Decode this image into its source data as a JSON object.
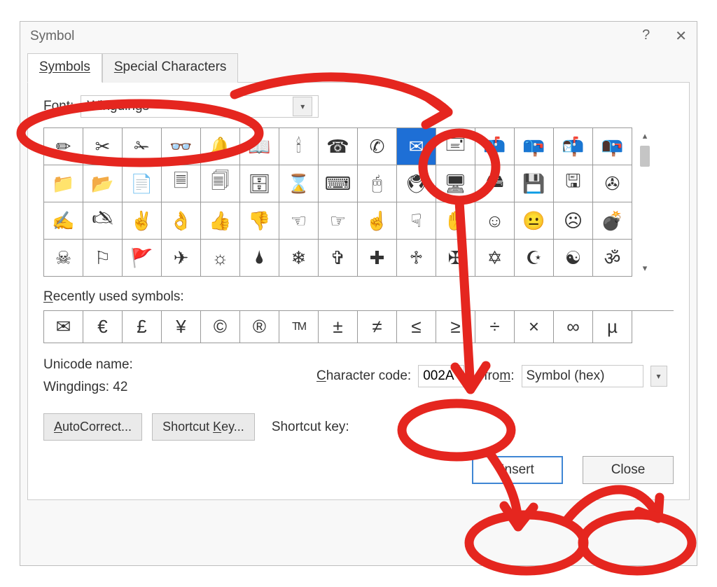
{
  "title": "Symbol",
  "tabs": {
    "symbols": "Symbols",
    "special": "Special Characters"
  },
  "font": {
    "label": "Font:",
    "value": "Wingdings"
  },
  "grid": [
    [
      "pencil-icon",
      "✏"
    ],
    [
      "scissors-icon",
      "✂"
    ],
    [
      "scissors-cut-icon",
      "✁"
    ],
    [
      "glasses-icon",
      "👓"
    ],
    [
      "bell-icon",
      "🔔"
    ],
    [
      "book-open-icon",
      "📖"
    ],
    [
      "candle-icon",
      "🕯"
    ],
    [
      "telephone-icon",
      "☎"
    ],
    [
      "telephone-rotary-icon",
      "✆"
    ],
    [
      "envelope-icon",
      "✉"
    ],
    [
      "envelope-stamped-icon",
      "🖃"
    ],
    [
      "mailbox-flag-up-icon",
      "📫"
    ],
    [
      "mailbox-flag-down-icon",
      "📪"
    ],
    [
      "mailbox-open-flag-icon",
      "📬"
    ],
    [
      "mailbox-open-icon",
      "📭"
    ],
    [
      "folder-icon",
      "📁"
    ],
    [
      "folder-open-icon",
      "📂"
    ],
    [
      "document-icon",
      "📄"
    ],
    [
      "page-icon",
      "🗏"
    ],
    [
      "documents-icon",
      "🗐"
    ],
    [
      "filing-cabinet-icon",
      "🗄"
    ],
    [
      "hourglass-icon",
      "⌛"
    ],
    [
      "keyboard-icon",
      "⌨"
    ],
    [
      "mouse-icon",
      "🖰"
    ],
    [
      "trackball-icon",
      "🖲"
    ],
    [
      "computer-icon",
      "🖥"
    ],
    [
      "hard-disk-icon",
      "🖴"
    ],
    [
      "floppy-disk-icon",
      "💾"
    ],
    [
      "floppy-disk-inverse-icon",
      "🖫"
    ],
    [
      "tape-icon",
      "✇"
    ],
    [
      "write-hand-icon",
      "✍"
    ],
    [
      "write-hand-left-icon",
      "🖎"
    ],
    [
      "victory-hand-icon",
      "✌"
    ],
    [
      "ok-hand-icon",
      "👌"
    ],
    [
      "thumbs-up-icon",
      "👍"
    ],
    [
      "thumbs-down-icon",
      "👎"
    ],
    [
      "point-left-icon",
      "☜"
    ],
    [
      "point-right-icon",
      "☞"
    ],
    [
      "point-up-icon",
      "☝"
    ],
    [
      "point-down-icon",
      "☟"
    ],
    [
      "open-hand-icon",
      "✋"
    ],
    [
      "smile-icon",
      "☺"
    ],
    [
      "neutral-face-icon",
      "😐"
    ],
    [
      "frown-icon",
      "☹"
    ],
    [
      "bomb-icon",
      "💣"
    ],
    [
      "skull-crossbones-icon",
      "☠"
    ],
    [
      "flag-icon",
      "⚐"
    ],
    [
      "pennant-icon",
      "🚩"
    ],
    [
      "airplane-icon",
      "✈"
    ],
    [
      "sun-icon",
      "☼"
    ],
    [
      "droplet-icon",
      "🌢"
    ],
    [
      "snowflake-icon",
      "❄"
    ],
    [
      "latin-cross-icon",
      "✞"
    ],
    [
      "cross-icon",
      "✚"
    ],
    [
      "celtic-cross-icon",
      "♱"
    ],
    [
      "maltese-cross-icon",
      "✠"
    ],
    [
      "star-of-david-icon",
      "✡"
    ],
    [
      "star-crescent-icon",
      "☪"
    ],
    [
      "yin-yang-icon",
      "☯"
    ],
    [
      "om-icon",
      "ॐ"
    ]
  ],
  "selected_index": 9,
  "recently_used": {
    "label": "Recently used symbols:"
  },
  "recent": [
    [
      "envelope-icon",
      "✉"
    ],
    [
      "euro-icon",
      "€"
    ],
    [
      "pound-icon",
      "£"
    ],
    [
      "yen-icon",
      "¥"
    ],
    [
      "copyright-icon",
      "©"
    ],
    [
      "registered-icon",
      "®"
    ],
    [
      "trademark-icon",
      "™"
    ],
    [
      "plus-minus-icon",
      "±"
    ],
    [
      "not-equal-icon",
      "≠"
    ],
    [
      "less-equal-icon",
      "≤"
    ],
    [
      "greater-equal-icon",
      "≥"
    ],
    [
      "division-icon",
      "÷"
    ],
    [
      "multiply-icon",
      "×"
    ],
    [
      "infinity-icon",
      "∞"
    ],
    [
      "mu-icon",
      "µ"
    ]
  ],
  "unicode_name": {
    "label": "Unicode name:",
    "value": "Wingdings: 42"
  },
  "char_code": {
    "label": "Character code:",
    "value": "002A"
  },
  "from": {
    "label": "from:",
    "value": "Symbol (hex)"
  },
  "autocorrect": "AutoCorrect...",
  "shortcut_key_btn": "Shortcut Key...",
  "shortcut_key_lbl": "Shortcut key:",
  "insert": "Insert",
  "close": "Close",
  "help_icon": "?",
  "close_icon": "✕"
}
